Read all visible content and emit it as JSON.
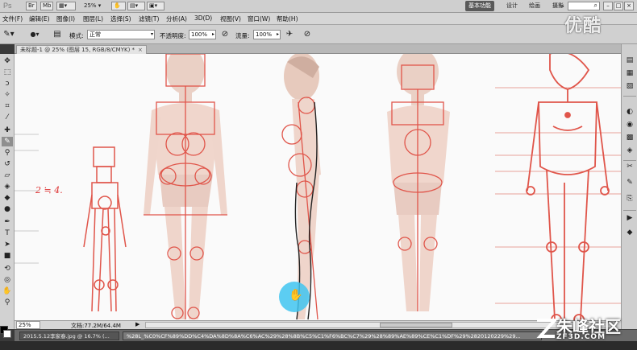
{
  "app": {
    "logo": "Ps",
    "chips": [
      "Br",
      "Mb"
    ],
    "zoom": "25%",
    "zoom_arrow": "▾",
    "workspaces": [
      "基本功能",
      "设计",
      "绘画",
      "摄影"
    ],
    "active_workspace": "基本功能",
    "more": "»",
    "window_buttons": [
      "–",
      "□",
      "×"
    ]
  },
  "menu": [
    "文件(F)",
    "编辑(E)",
    "图像(I)",
    "图层(L)",
    "选择(S)",
    "滤镜(T)",
    "分析(A)",
    "3D(D)",
    "视图(V)",
    "窗口(W)",
    "帮助(H)"
  ],
  "options": {
    "mode_label": "模式:",
    "mode_value": "正常",
    "opacity_label": "不透明度:",
    "opacity_value": "100%",
    "flow_label": "流量:",
    "flow_value": "100%"
  },
  "document": {
    "tab_title": "未标题-1 @ 25% (图层 15, RGB/8/CMYK) *",
    "close": "×"
  },
  "status": {
    "zoom": "25%",
    "doc_size": "文档:77.2M/64.4M",
    "arrow": "▶"
  },
  "file_tabs": [
    {
      "label": "2015.5.12李家春.jpg @ 16.7% (...",
      "active": false
    },
    {
      "label": "%28L_%C0%CF%89%DD%C4%DA%8D%8A%C6%AC%29%28%8B%C5%C1%F6%BC%C7%29%28%89%AE%89%CE%C1%DF%29%2820120229%29...",
      "active": true
    }
  ],
  "canvas_note": "2 ≒ 4.",
  "watermarks": {
    "top": "优酷",
    "bottom_zh": "朱峰社区",
    "bottom_en": "ZF3D.COM"
  },
  "colors": {
    "accent_sketch": "#e0554a",
    "skin": "#f0d2c8",
    "cursor": "#40c4f0"
  },
  "tools": [
    "move-tool",
    "marquee-tool",
    "lasso-tool",
    "quick-select-tool",
    "crop-tool",
    "eyedropper-tool",
    "healing-tool",
    "brush-tool",
    "clone-stamp-tool",
    "history-brush-tool",
    "eraser-tool",
    "gradient-tool",
    "blur-tool",
    "dodge-tool",
    "pen-tool",
    "type-tool",
    "path-select-tool",
    "shape-tool",
    "3d-rotate-tool",
    "3d-orbit-tool",
    "hand-tool",
    "zoom-tool"
  ],
  "dock_icons": [
    "layers-icon",
    "channels-icon",
    "paths-icon",
    "adjustments-icon",
    "masks-icon",
    "swatches-icon",
    "styles-icon",
    "tools-icon",
    "brush-icon",
    "clone-icon",
    "actions-icon",
    "history-icon"
  ]
}
